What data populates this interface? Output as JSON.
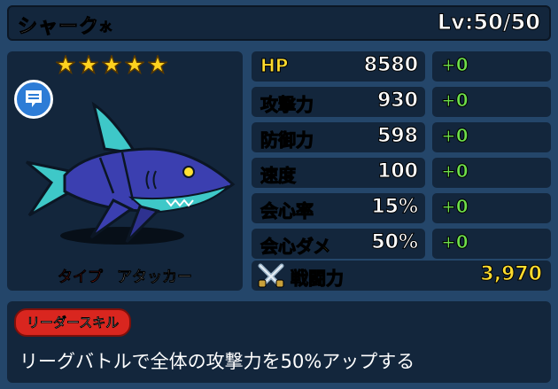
{
  "header": {
    "name": "シャーク",
    "element": "水",
    "level": "Lv:50/50"
  },
  "character": {
    "stars": 5,
    "type_label": "タイプ",
    "type_value": "アタッカー"
  },
  "stats": [
    {
      "label": "HP",
      "value": "8580",
      "bonus": "+0"
    },
    {
      "label": "攻撃力",
      "value": "930",
      "bonus": "+0"
    },
    {
      "label": "防御力",
      "value": "598",
      "bonus": "+0"
    },
    {
      "label": "速度",
      "value": "100",
      "bonus": "+0"
    },
    {
      "label": "会心率",
      "value": "15%",
      "bonus": "+0"
    },
    {
      "label": "会心ダメ",
      "value": "50%",
      "bonus": "+0"
    }
  ],
  "power": {
    "label": "戦闘力",
    "value": "3,970"
  },
  "skill": {
    "badge": "リーダースキル",
    "text": "リーグバトルで全体の攻撃力を50%アップする"
  },
  "colors": {
    "panel": "#13263c",
    "frame": "#24466a",
    "label": "#ffdc2e",
    "bonus": "#6ee04a",
    "type": "#e8332b"
  }
}
